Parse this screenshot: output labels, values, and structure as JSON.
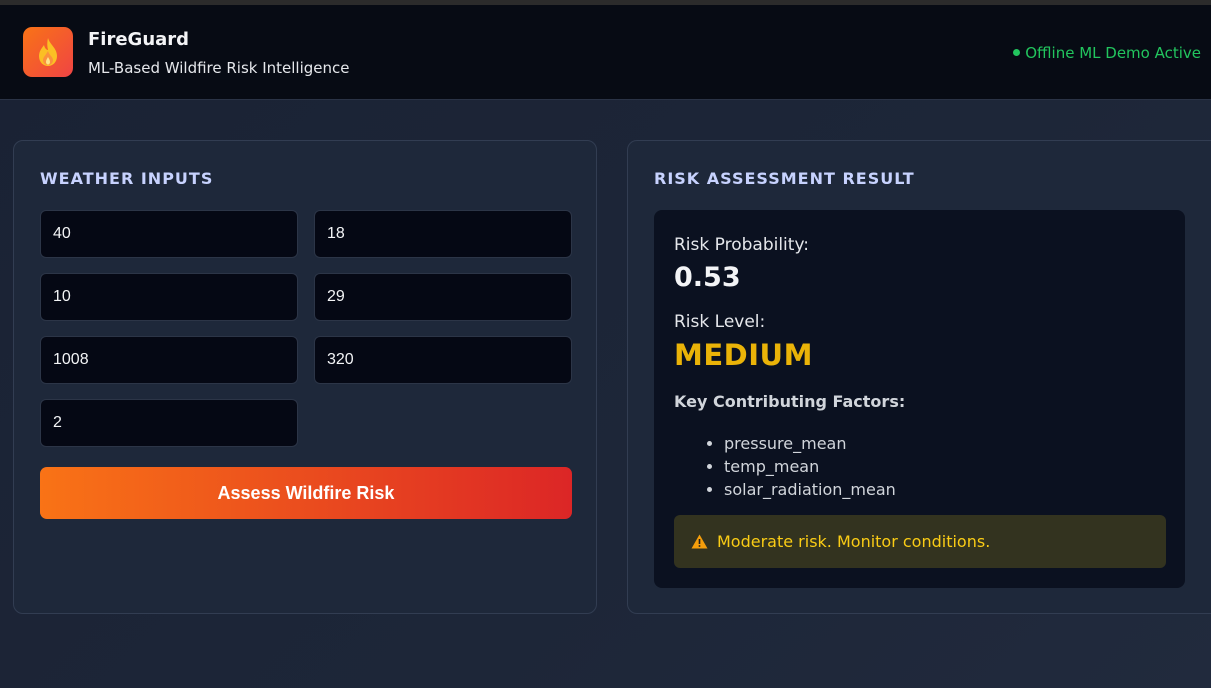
{
  "header": {
    "title": "FireGuard",
    "subtitle": "ML-Based Wildfire Risk Intelligence",
    "status": "Offline ML Demo Active",
    "logo_icon": "flame-icon"
  },
  "inputs_panel": {
    "title": "WEATHER INPUTS",
    "fields": [
      "40",
      "18",
      "10",
      "29",
      "1008",
      "320",
      "2"
    ],
    "submit_label": "Assess Wildfire Risk"
  },
  "result_panel": {
    "title": "RISK ASSESSMENT RESULT",
    "probability_label": "Risk Probability:",
    "probability_value": "0.53",
    "level_label": "Risk Level:",
    "level_value": "MEDIUM",
    "factors_title": "Key Contributing Factors:",
    "factors": [
      "pressure_mean",
      "temp_mean",
      "solar_radiation_mean"
    ],
    "warning_icon": "warning-icon",
    "warning_text": "Moderate risk. Monitor conditions."
  },
  "colors": {
    "accent_orange": "#f97316",
    "accent_red": "#dc2626",
    "status_green": "#22c55e",
    "level_medium": "#eab308"
  }
}
